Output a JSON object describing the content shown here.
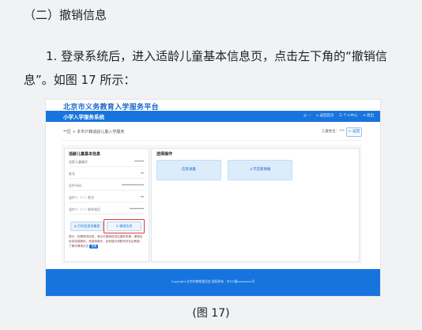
{
  "doc": {
    "heading": "（二）撤销信息",
    "paragraph": "1. 登录系统后，进入适龄儿童基本信息页，点击左下角的“撤销信息”。如图 17 所示：",
    "caption": "(图 17)"
  },
  "screenshot": {
    "site_title": "北京市义务教育入学服务平台",
    "topbar_title": "小学入学服务系统",
    "topbar_right": [
      "◎ ···",
      "⌂ 返回首页",
      "☰ 个人中心",
      "⇥ 退出"
    ],
    "breadcrumb": "**区 > 本市户籍适龄儿童入学服务",
    "breadcrumb_right": "儿童姓名：***",
    "back_button": "← 返回",
    "left_card": {
      "title": "适龄儿童基本信息",
      "fields": [
        {
          "label": "适龄儿童编号",
          "value": "******"
        },
        {
          "label": "姓名",
          "value": "**"
        },
        {
          "label": "证件号码",
          "value": "**************"
        },
        {
          "label": "监护人（一）姓名",
          "value": "**"
        },
        {
          "label": "监护人（一）联系电话",
          "value": "*********"
        }
      ],
      "print_button": "⊕ 打印信息采集表",
      "cancel_button": "↻ 撤销信息",
      "notice": "提示：如需修改信息，请点击撤销信息后重新采集；撤销后信息将被删除，请谨慎操作，如有疑问请联系所在区教委，了解详情请点击",
      "notice_button": "查看"
    },
    "right_panel": {
      "title": "选择操作",
      "tiles": [
        "信息采集",
        "入学志愿填报"
      ]
    },
    "footer": "Copyright 北京市教育委员会 版权所有 · 京ICP备xxxxxxxx号"
  }
}
